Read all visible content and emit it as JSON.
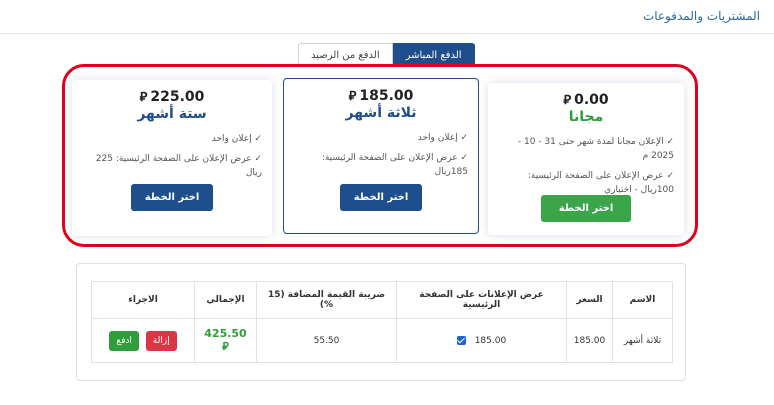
{
  "header": {
    "title": "المشتريات والمدفوعات"
  },
  "tabs": [
    {
      "label": "الدفع المباشر",
      "active": true
    },
    {
      "label": "الدفع من الرصيد",
      "active": false
    }
  ],
  "currency_symbol": "⃁",
  "plans": [
    {
      "price": "0.00",
      "name": "مجانا",
      "features": [
        "✓ الإعلان مجانا لمدة شهر حتى 31 - 10 - 2025 م",
        "✓ عرض الإعلان على الصفحة الرئيسية: 100ريال - اختياري"
      ],
      "button": "اختر الخطة"
    },
    {
      "price": "185.00",
      "name": "ثلاثة أشهر",
      "features": [
        "✓ إعلان واحد",
        "✓ عرض الإعلان على الصفحة الرئيسية: 185ريال"
      ],
      "button": "اختر الخطة"
    },
    {
      "price": "225.00",
      "name": "ستة أشهر",
      "features": [
        "✓ إعلان واحد",
        "✓ عرض الإعلان على الصفحة الرئيسية: 225 ريال"
      ],
      "button": "اختر الخطة"
    }
  ],
  "table": {
    "headers": [
      "الاسم",
      "السعر",
      "عرض الإعلانات على الصفحة الرئيسية",
      "ضريبة القيمة المضافة (15 %)",
      "الإجمالي",
      "الاجراء"
    ],
    "row": {
      "name": "ثلاثة أشهر",
      "price": "185.00",
      "homepage_value": "185.00",
      "homepage_checked": true,
      "vat": "55.50",
      "total": "425.50",
      "remove_label": "إزالة",
      "pay_label": "ادفع"
    }
  },
  "colors": {
    "primary": "#1f4e8c",
    "success": "#3aa549",
    "danger": "#dc3545",
    "highlight": "#e0001b"
  }
}
